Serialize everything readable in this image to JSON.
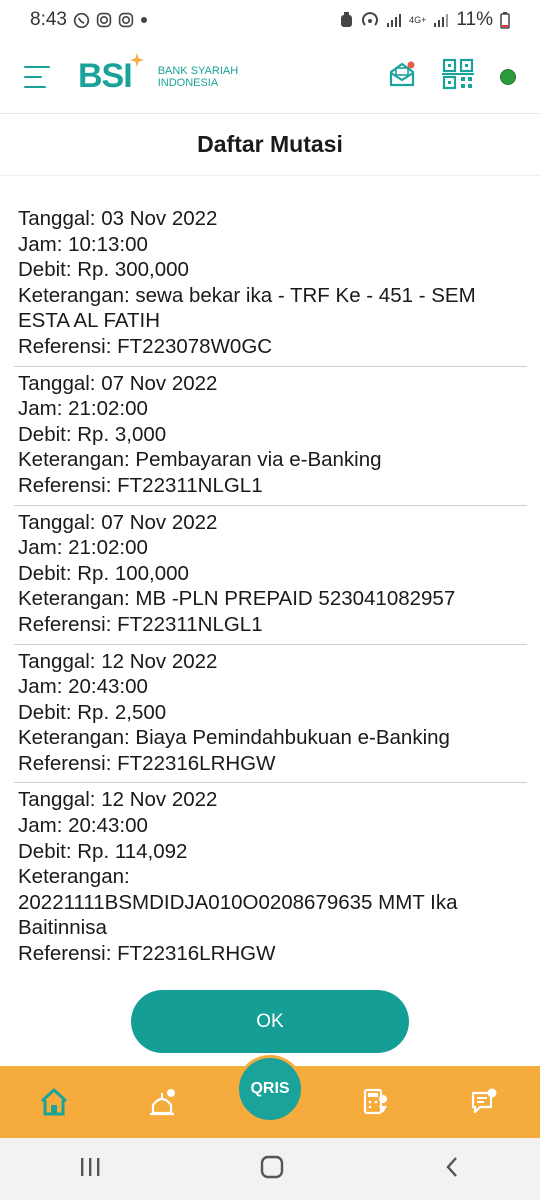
{
  "status": {
    "time": "8:43",
    "battery": "11%",
    "net": "4G+"
  },
  "header": {
    "logo": "BSI",
    "bank_line1": "BANK SYARIAH",
    "bank_line2": "INDONESIA"
  },
  "page": {
    "title": "Daftar Mutasi"
  },
  "transactions": [
    {
      "tanggal": "Tanggal: 03 Nov 2022",
      "jam": "Jam: 10:13:00",
      "debit": "Debit: Rp. 300,000",
      "keterangan": "Keterangan: sewa bekar ika - TRF Ke - 451 - SEM ESTA AL FATIH",
      "referensi": "Referensi: FT223078W0GC"
    },
    {
      "tanggal": "Tanggal: 07 Nov 2022",
      "jam": "Jam: 21:02:00",
      "debit": "Debit: Rp. 3,000",
      "keterangan": "Keterangan: Pembayaran via e-Banking",
      "referensi": "Referensi: FT22311NLGL1"
    },
    {
      "tanggal": "Tanggal: 07 Nov 2022",
      "jam": "Jam: 21:02:00",
      "debit": "Debit: Rp. 100,000",
      "keterangan": "Keterangan: MB -PLN PREPAID 523041082957",
      "referensi": "Referensi: FT22311NLGL1"
    },
    {
      "tanggal": "Tanggal: 12 Nov 2022",
      "jam": "Jam: 20:43:00",
      "debit": "Debit: Rp. 2,500",
      "keterangan": "Keterangan: Biaya Pemindahbukuan e-Banking",
      "referensi": "Referensi: FT22316LRHGW"
    },
    {
      "tanggal": "Tanggal: 12 Nov 2022",
      "jam": "Jam: 20:43:00",
      "debit": "Debit: Rp. 114,092",
      "keterangan": "Keterangan:\n20221111BSMDIDJA010O0208679635 MMT Ika Baitinnisa",
      "referensi": "Referensi: FT22316LRHGW"
    }
  ],
  "actions": {
    "ok_label": "OK"
  },
  "bottom_nav": {
    "qris_label": "QRIS"
  },
  "colors": {
    "brand_teal": "#1aa39a",
    "nav_orange": "#f5ac3c",
    "online_green": "#2e9a3e"
  }
}
